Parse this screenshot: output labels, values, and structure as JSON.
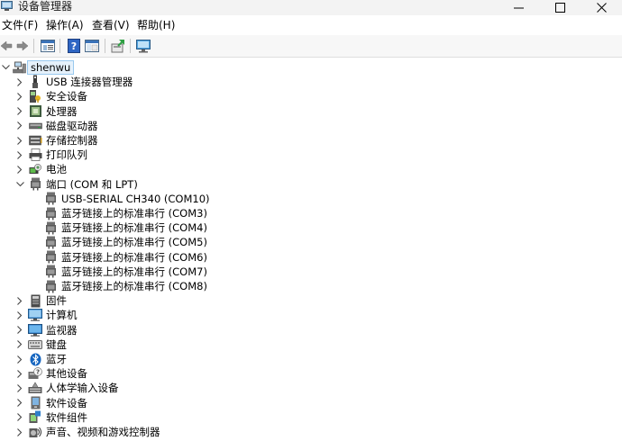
{
  "window": {
    "title": "设备管理器"
  },
  "menu": [
    {
      "label": "文件(F)"
    },
    {
      "label": "操作(A)"
    },
    {
      "label": "查看(V)"
    },
    {
      "label": "帮助(H)"
    }
  ],
  "toolbar": [
    {
      "icon": "back-arrow-icon"
    },
    {
      "icon": "forward-arrow-icon"
    },
    {
      "icon": "properties-icon"
    },
    {
      "icon": "help-icon"
    },
    {
      "icon": "view-panel-icon"
    },
    {
      "icon": "update-driver-icon"
    },
    {
      "icon": "scan-hardware-icon"
    }
  ],
  "tree": {
    "root": {
      "label": "shenwu"
    },
    "categories": [
      {
        "label": "USB 连接器管理器",
        "icon": "usb-icon",
        "expanded": false
      },
      {
        "label": "安全设备",
        "icon": "security-key-icon",
        "expanded": false
      },
      {
        "label": "处理器",
        "icon": "processor-icon",
        "expanded": false
      },
      {
        "label": "磁盘驱动器",
        "icon": "disk-drive-icon",
        "expanded": false
      },
      {
        "label": "存储控制器",
        "icon": "storage-controller-icon",
        "expanded": false
      },
      {
        "label": "打印队列",
        "icon": "printer-icon",
        "expanded": false
      },
      {
        "label": "电池",
        "icon": "battery-icon",
        "expanded": false
      },
      {
        "label": "端口 (COM 和 LPT)",
        "icon": "port-icon",
        "expanded": true,
        "children": [
          {
            "label": "USB-SERIAL CH340 (COM10)",
            "icon": "port-icon"
          },
          {
            "label": "蓝牙链接上的标准串行 (COM3)",
            "icon": "port-icon"
          },
          {
            "label": "蓝牙链接上的标准串行 (COM4)",
            "icon": "port-icon"
          },
          {
            "label": "蓝牙链接上的标准串行 (COM5)",
            "icon": "port-icon"
          },
          {
            "label": "蓝牙链接上的标准串行 (COM6)",
            "icon": "port-icon"
          },
          {
            "label": "蓝牙链接上的标准串行 (COM7)",
            "icon": "port-icon"
          },
          {
            "label": "蓝牙链接上的标准串行 (COM8)",
            "icon": "port-icon"
          }
        ]
      },
      {
        "label": "固件",
        "icon": "firmware-icon",
        "expanded": false
      },
      {
        "label": "计算机",
        "icon": "computer-icon",
        "expanded": false
      },
      {
        "label": "监视器",
        "icon": "monitor-icon",
        "expanded": false
      },
      {
        "label": "键盘",
        "icon": "keyboard-icon",
        "expanded": false
      },
      {
        "label": "蓝牙",
        "icon": "bluetooth-icon",
        "expanded": false
      },
      {
        "label": "其他设备",
        "icon": "unknown-device-icon",
        "expanded": false
      },
      {
        "label": "人体学输入设备",
        "icon": "hid-icon",
        "expanded": false
      },
      {
        "label": "软件设备",
        "icon": "software-device-icon",
        "expanded": false
      },
      {
        "label": "软件组件",
        "icon": "software-component-icon",
        "expanded": false
      },
      {
        "label": "声音、视频和游戏控制器",
        "icon": "sound-icon",
        "expanded": false
      }
    ]
  }
}
